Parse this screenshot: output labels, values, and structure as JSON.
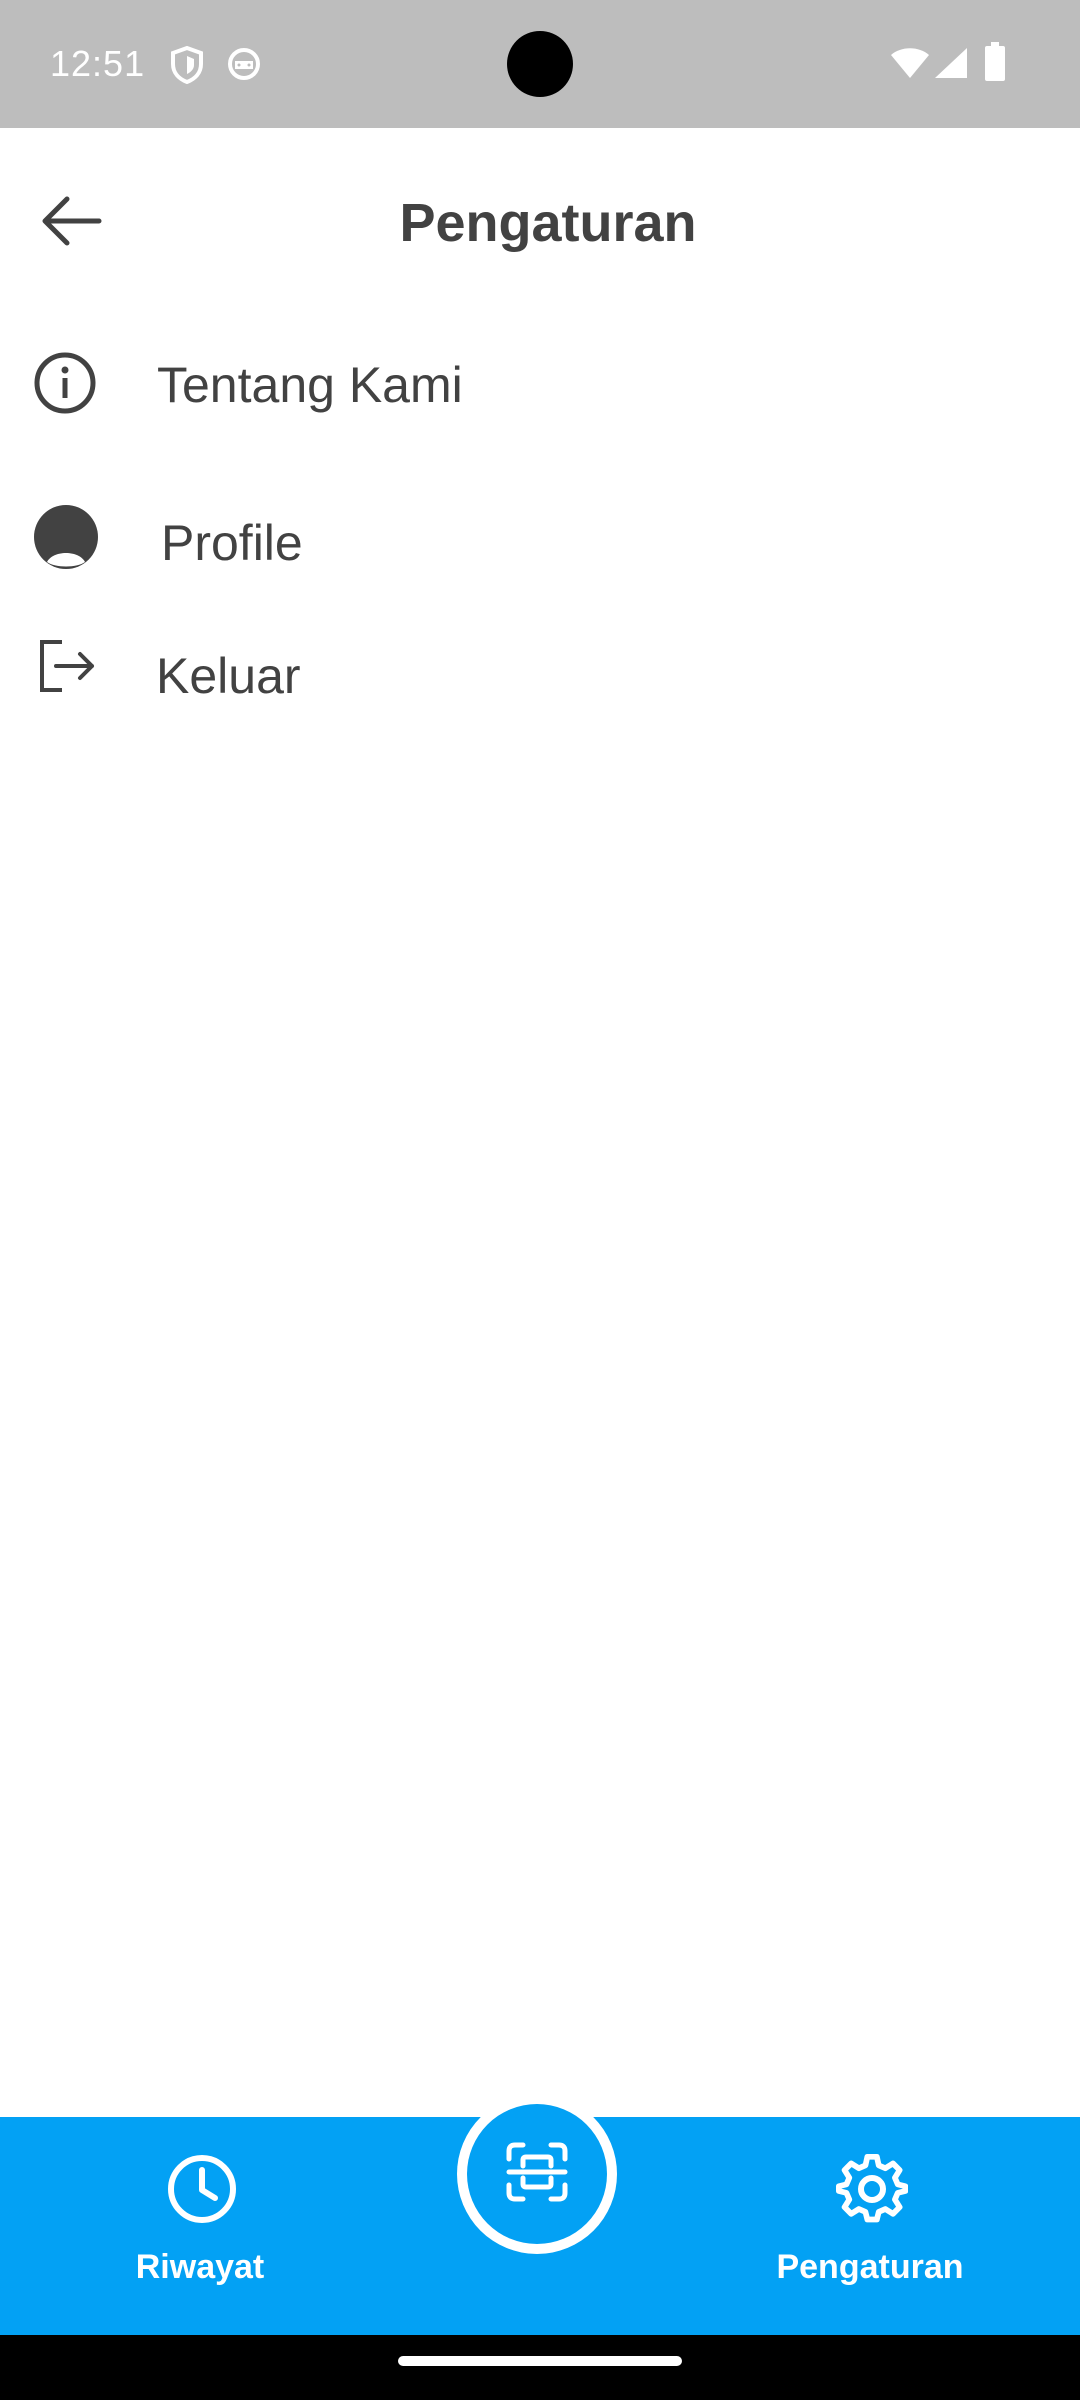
{
  "status_bar": {
    "time": "12:51",
    "icons": [
      "shield-icon",
      "android-icon",
      "wifi-icon",
      "signal-icon",
      "battery-icon"
    ]
  },
  "app_bar": {
    "back_icon": "arrow-left-icon",
    "title": "Pengaturan"
  },
  "menu": {
    "items": [
      {
        "icon": "info-icon",
        "label": "Tentang Kami"
      },
      {
        "icon": "profile-icon",
        "label": "Profile"
      },
      {
        "icon": "logout-icon",
        "label": "Keluar"
      }
    ]
  },
  "bottom_nav": {
    "items": [
      {
        "icon": "clock-icon",
        "label": "Riwayat"
      },
      {
        "icon": "scan-icon",
        "label": ""
      },
      {
        "icon": "gear-icon",
        "label": "Pengaturan"
      }
    ]
  },
  "colors": {
    "status_bar": "#bdbdbd",
    "accent": "#03a1f4",
    "text": "#424242",
    "background": "#ffffff"
  }
}
